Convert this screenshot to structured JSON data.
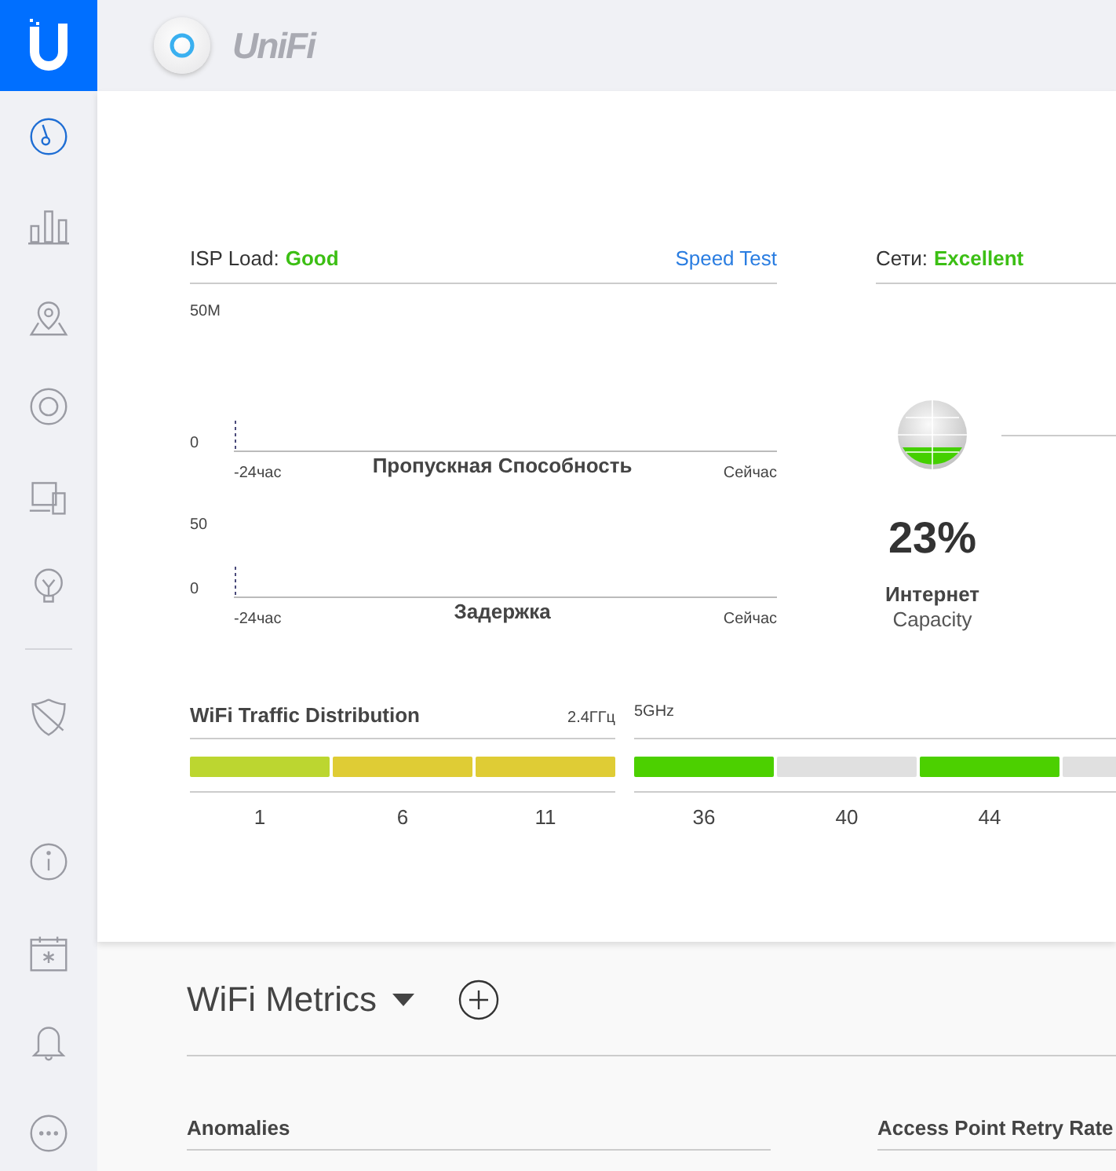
{
  "header": {
    "brand": "UniFi"
  },
  "sidebar": {
    "main_items": [
      {
        "selected": true
      },
      {
        "selected": false
      },
      {
        "selected": false
      },
      {
        "selected": false
      },
      {
        "selected": false
      },
      {
        "selected": false
      }
    ],
    "secondary_items": [
      {
        "selected": false
      }
    ],
    "footer_items": [
      {
        "selected": false
      },
      {
        "selected": false
      },
      {
        "selected": false
      },
      {
        "selected": false
      }
    ]
  },
  "isp_load": {
    "label": "ISP Load:",
    "status": "Good",
    "link": "Speed Test",
    "charts": [
      {
        "y_max": "50M",
        "y_min": "0",
        "x_start": "-24час",
        "title": "Пропускная Способность",
        "x_end": "Сейчас"
      },
      {
        "y_max": "50",
        "y_min": "0",
        "x_start": "-24час",
        "title": "Задержка",
        "x_end": "Сейчас"
      }
    ]
  },
  "networks": {
    "label": "Сети:",
    "status": "Excellent",
    "value": "23%",
    "name": "Интернет",
    "caption": "Capacity"
  },
  "wifi_traffic": {
    "title": "WiFi Traffic Distribution",
    "bands": [
      {
        "label": "2.4ГГц",
        "channels": [
          {
            "label": "1",
            "color": "#bcd630"
          },
          {
            "label": "6",
            "color": "#dfcc35"
          },
          {
            "label": "11",
            "color": "#dfcc35"
          }
        ]
      },
      {
        "label": "5GHz",
        "channels": [
          {
            "label": "36",
            "color": "#4cd000"
          },
          {
            "label": "40",
            "color": "#e0e0e0"
          },
          {
            "label": "44",
            "color": "#4cd000"
          },
          {
            "color": "#e0e0e0"
          }
        ]
      }
    ]
  },
  "wifi_metrics": {
    "title": "WiFi Metrics",
    "panels": [
      {
        "title": "Anomalies"
      },
      {
        "title": "Access Point Retry Rate"
      }
    ]
  }
}
